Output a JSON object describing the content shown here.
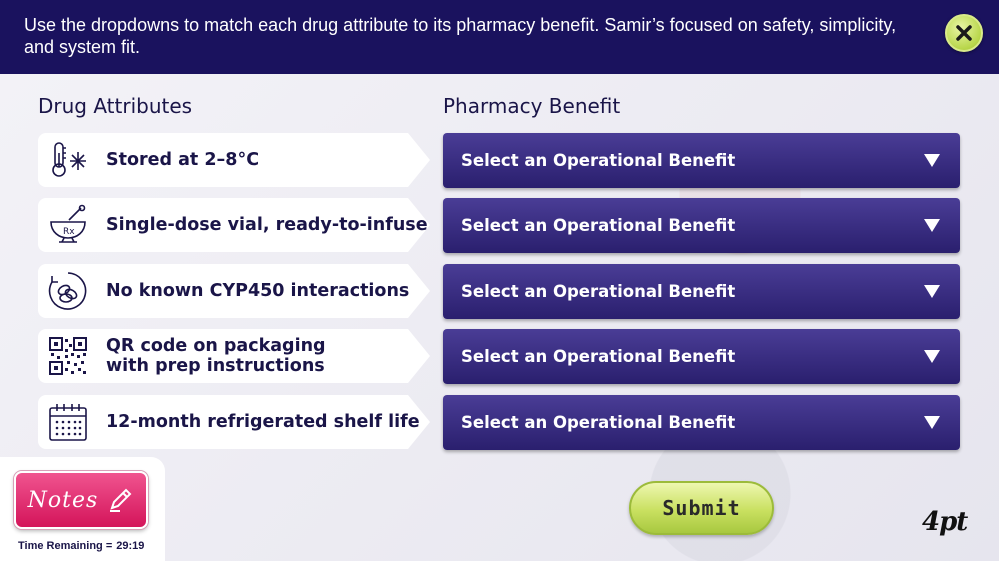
{
  "header": {
    "instruction": "Use the dropdowns to match each drug attribute to its pharmacy benefit. Samir’s focused on safety, simplicity, and system fit.",
    "close_icon": "close-x-icon"
  },
  "columns": {
    "left_heading": "Drug Attributes",
    "right_heading": "Pharmacy Benefit"
  },
  "attributes": [
    {
      "label": "Stored at 2–8°C",
      "icon": "thermometer-snowflake-icon"
    },
    {
      "label": "Single-dose vial, ready-to-infuse",
      "icon": "mortar-pestle-icon"
    },
    {
      "label": "No known CYP450 interactions",
      "icon": "pill-cycle-icon"
    },
    {
      "label": "QR code on packaging with prep instructions",
      "icon": "qr-code-icon"
    },
    {
      "label": "12-month refrigerated shelf life",
      "icon": "calendar-icon"
    }
  ],
  "dropdowns": [
    {
      "value": "Select an Operational Benefit"
    },
    {
      "value": "Select an Operational Benefit"
    },
    {
      "value": "Select an Operational Benefit"
    },
    {
      "value": "Select an Operational Benefit"
    },
    {
      "value": "Select an Operational Benefit"
    }
  ],
  "notes": {
    "label": "Notes",
    "icon": "pencil-icon"
  },
  "timer": {
    "label": "Time Remaining =",
    "value": "29:19"
  },
  "submit": {
    "label": "Submit"
  },
  "logo": {
    "text": "4pt"
  },
  "colors": {
    "header_bg": "#1a125e",
    "dropdown_bg": "#3a2e84",
    "submit_bg": "#c9e060",
    "notes_bg": "#e0246a",
    "text_dark": "#1a1548"
  }
}
